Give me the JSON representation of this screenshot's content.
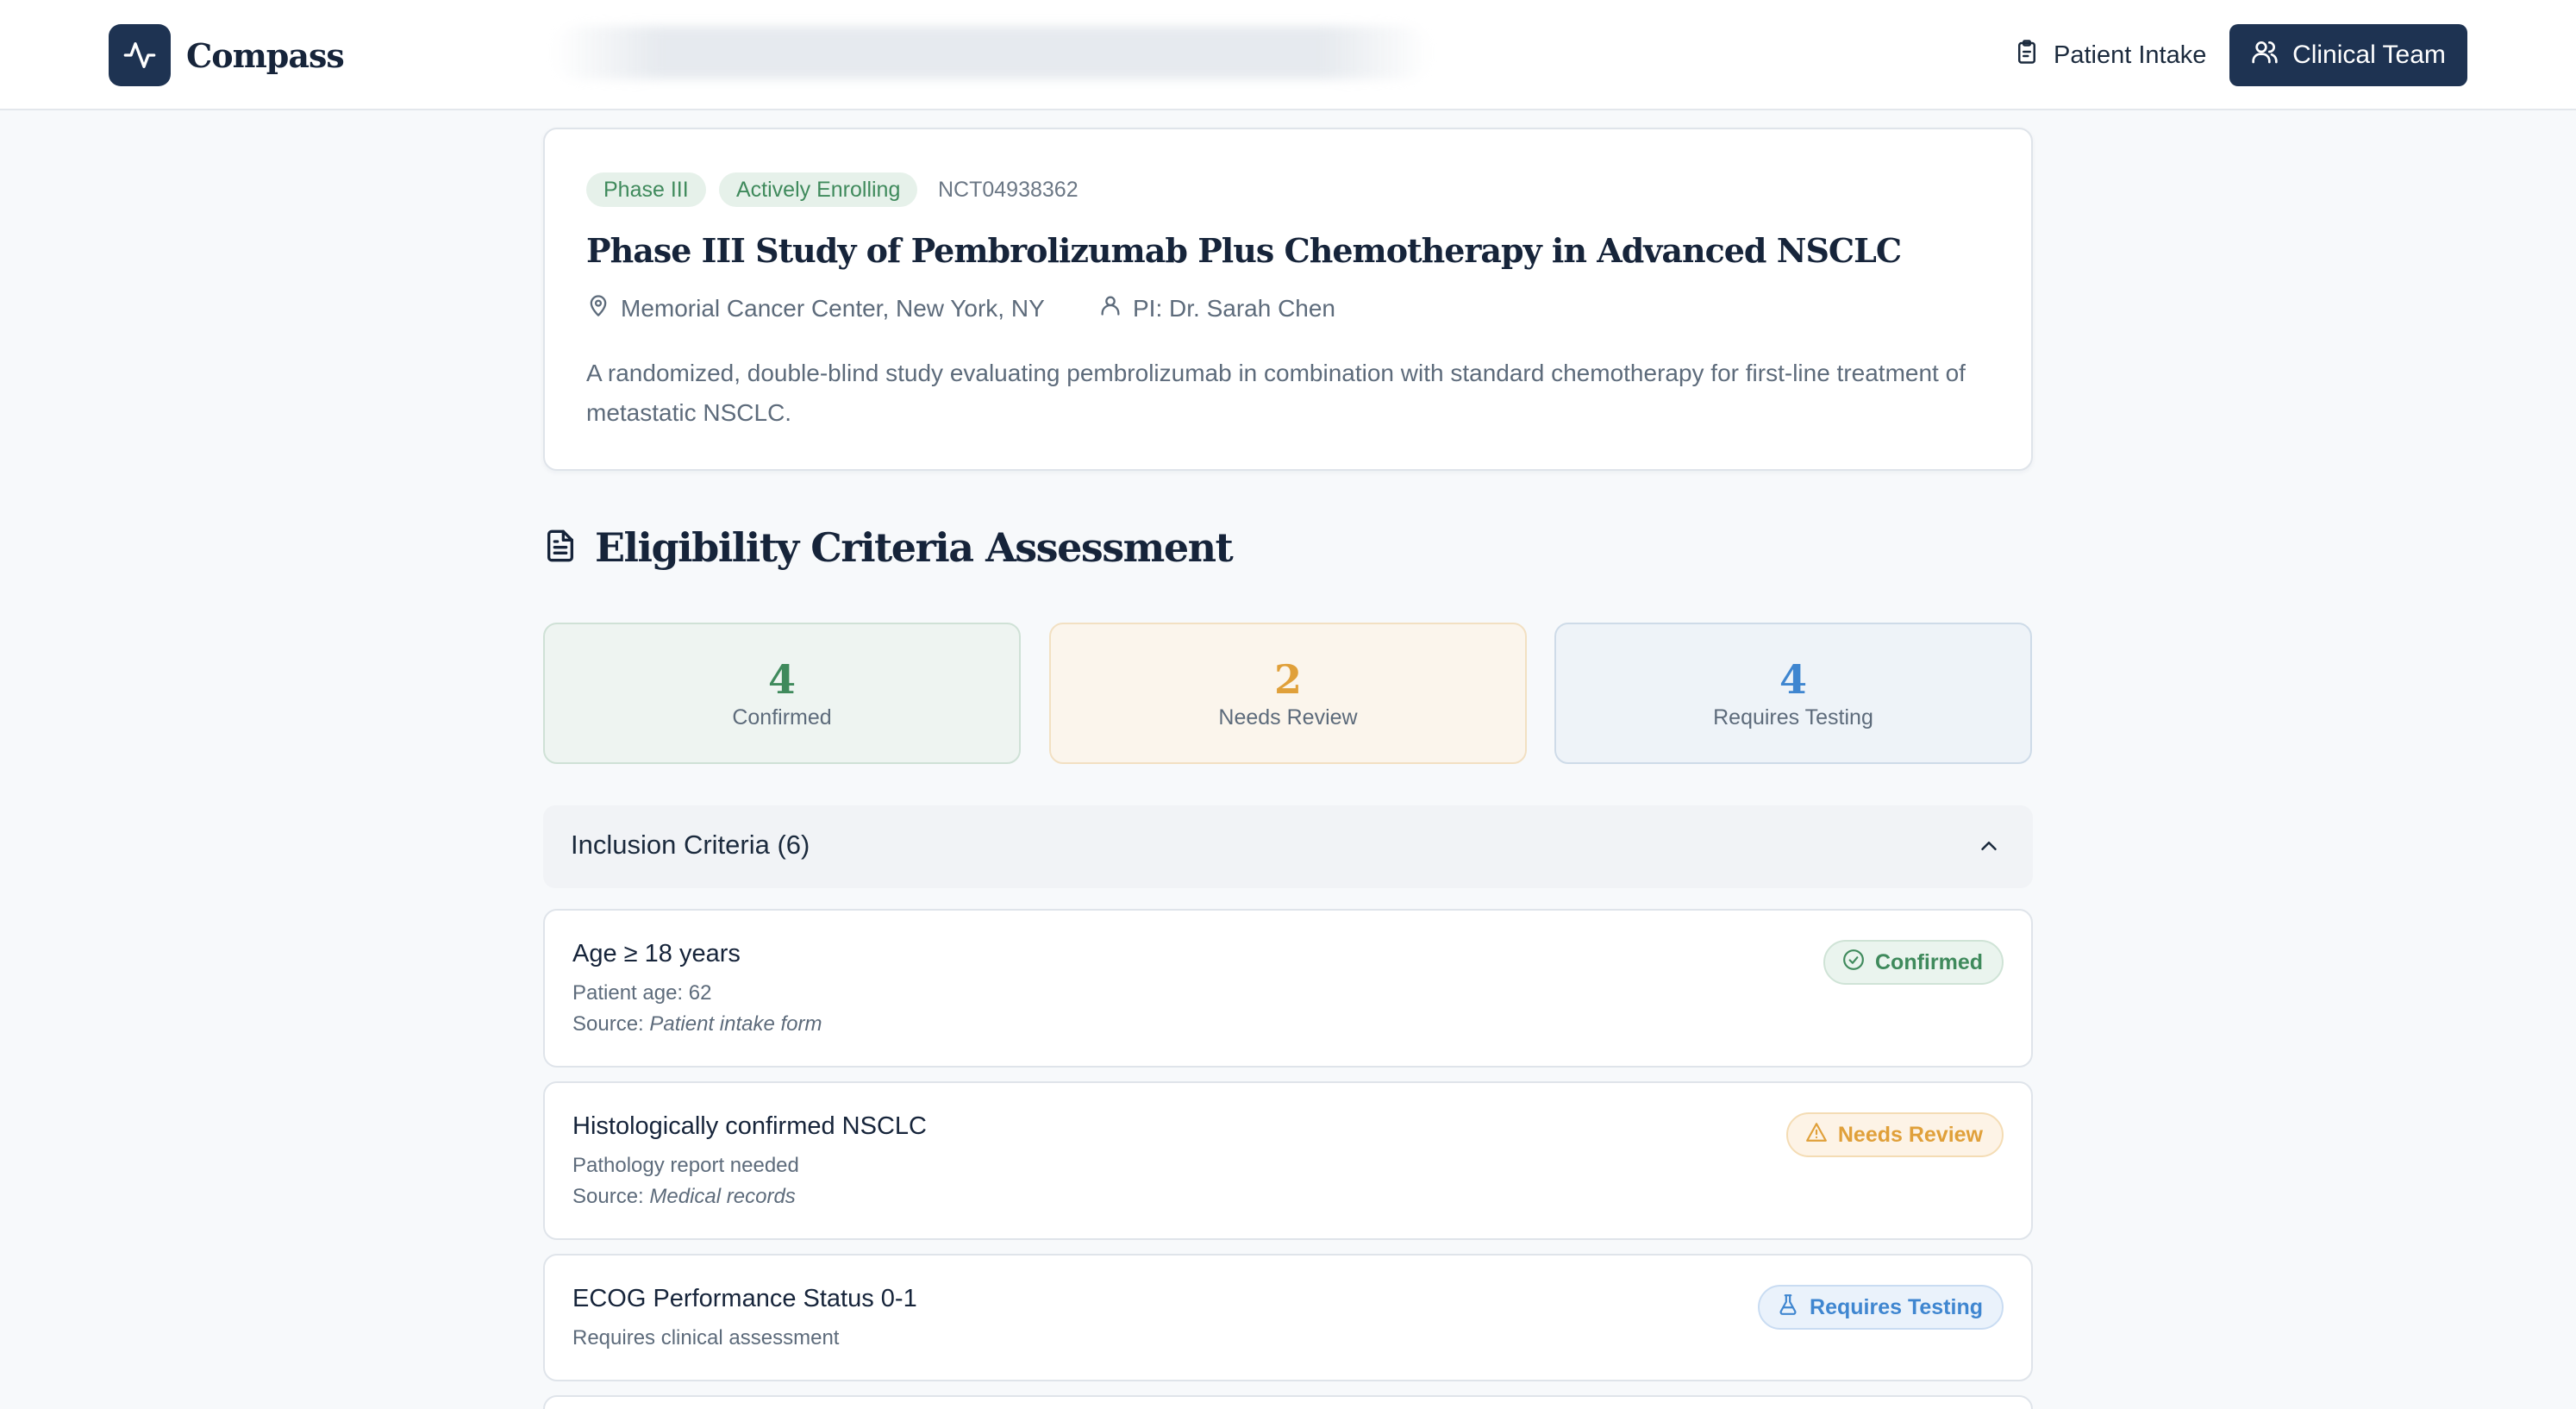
{
  "header": {
    "app_name": "Compass",
    "nav_intake": "Patient Intake",
    "nav_team": "Clinical Team"
  },
  "study": {
    "phase_badge": "Phase III",
    "status_badge": "Actively Enrolling",
    "nct_id": "NCT04938362",
    "title": "Phase III Study of Pembrolizumab Plus Chemotherapy in Advanced NSCLC",
    "location": "Memorial Cancer Center, New York, NY",
    "pi": "PI: Dr. Sarah Chen",
    "description": "A randomized, double-blind study evaluating pembrolizumab in combination with standard chemotherapy for first-line treatment of metastatic NSCLC."
  },
  "eligibility": {
    "title": "Eligibility Criteria Assessment",
    "summary": {
      "confirmed": {
        "count": "4",
        "label": "Confirmed"
      },
      "review": {
        "count": "2",
        "label": "Needs Review"
      },
      "testing": {
        "count": "4",
        "label": "Requires Testing"
      }
    },
    "inclusion_header": "Inclusion Criteria (6)",
    "criteria": [
      {
        "title": "Age ≥ 18 years",
        "detail": "Patient age: 62",
        "source_label": "Source:",
        "source": "Patient intake form",
        "status": "Confirmed"
      },
      {
        "title": "Histologically confirmed NSCLC",
        "detail": "Pathology report needed",
        "source_label": "Source:",
        "source": "Medical records",
        "status": "Needs Review"
      },
      {
        "title": "ECOG Performance Status 0-1",
        "detail": "Requires clinical assessment",
        "status": "Requires Testing"
      }
    ]
  },
  "colors": {
    "brand": "#1e3352",
    "confirmed": "#3f8a5c",
    "review": "#e0a03a",
    "testing": "#3f86d0"
  }
}
